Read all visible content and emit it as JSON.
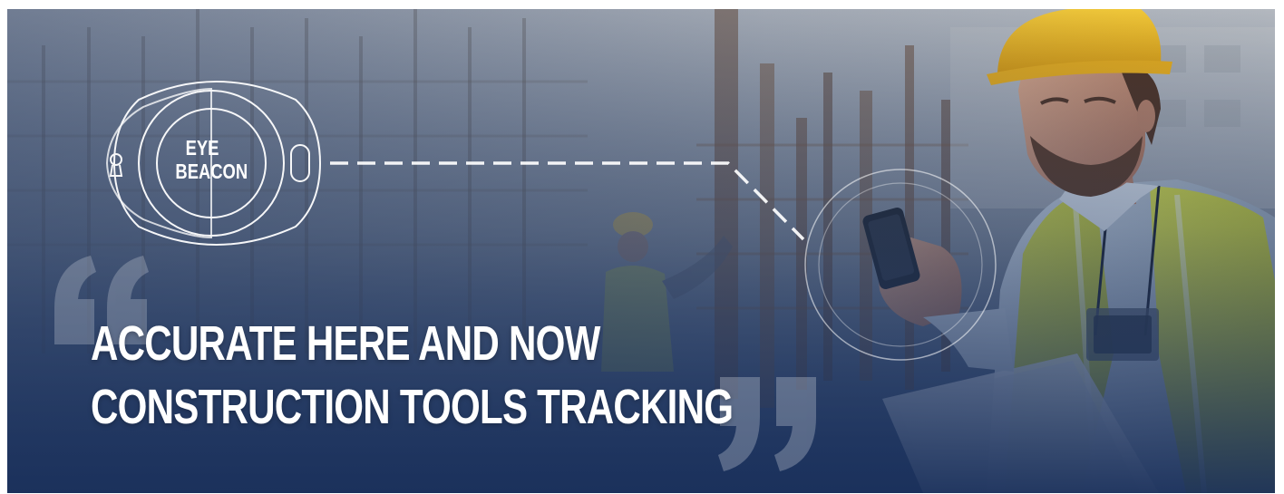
{
  "banner": {
    "headline_line1": "ACCURATE HERE AND NOW",
    "headline_line2": "CONSTRUCTION TOOLS TRACKING",
    "beacon_line1": "EYE",
    "beacon_line2": "BEACON"
  },
  "icons": {
    "beacon": "eye-beacon-device-icon",
    "open_quote": "open-quote-icon",
    "close_quote": "close-quote-icon",
    "phone_ring": "phone-signal-ring-icon",
    "connector": "dashed-connector-line"
  },
  "colors": {
    "text": "#ffffff",
    "overlay_navy": "#1f3662",
    "vest_yellow": "#c8d13a",
    "hardhat_yellow": "#f2bd1c"
  }
}
